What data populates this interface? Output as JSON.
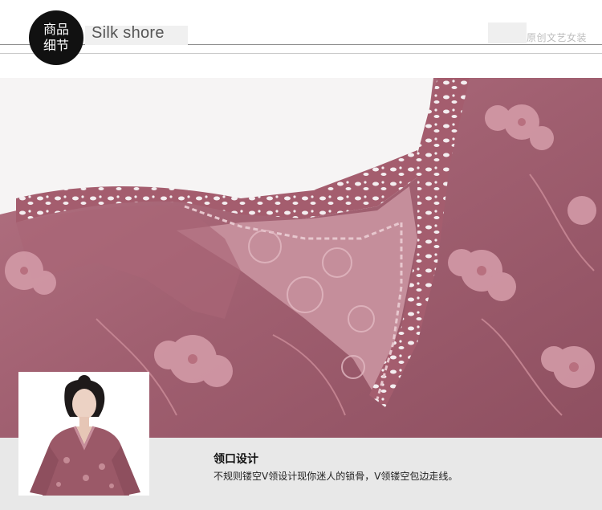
{
  "header": {
    "badge_line1": "商品",
    "badge_line2": "细节",
    "brand": "Silk shore",
    "tagline": "原创文艺女装"
  },
  "detail": {
    "title": "领口设计",
    "description": "不规则镂空V领设计现你迷人的锁骨，V领镂空包边走线。"
  },
  "colors": {
    "fabric": "#a46473",
    "lace": "#c48a95",
    "caption_band": "#e8e8e8"
  }
}
